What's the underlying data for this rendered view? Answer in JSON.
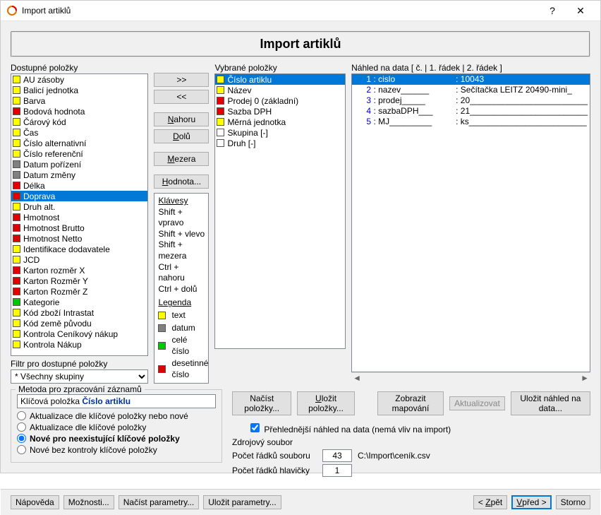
{
  "title": "Import artiklů",
  "panelTitle": "Import artiklů",
  "labels": {
    "available": "Dostupné položky",
    "selected": "Vybrané položky",
    "preview": "Náhled na data [ č. | 1. řádek | 2. řádek ]",
    "filter": "Filtr pro dostupné položky",
    "filterValue": "* Všechny skupiny"
  },
  "buttons": {
    "moveRight": ">>",
    "moveLeft": "<<",
    "up": "Nahoru",
    "down": "Dolů",
    "space": "Mezera",
    "value": "Hodnota...",
    "loadItems": "Načíst položky...",
    "saveItems": "Uložit položky...",
    "showMap": "Zobrazit mapování",
    "refresh": "Aktualizovat",
    "savePreview": "Uložit náhled na data...",
    "help": "Nápověda",
    "options": "Možnosti...",
    "loadParams": "Načíst parametry...",
    "saveParams": "Uložit parametry...",
    "back": "< Zpět",
    "next": "Vpřed >",
    "cancel": "Storno"
  },
  "hints": {
    "keysHdr": "Klávesy",
    "k1": "Shift + vpravo",
    "k2": "Shift + vlevo",
    "k3": "Shift + mezera",
    "k4": "Ctrl + nahoru",
    "k5": "Ctrl + dolů",
    "legendHdr": "Legenda",
    "lText": "text",
    "lDate": "datum",
    "lInt": "celé číslo",
    "lDec": "desetinné číslo"
  },
  "available": [
    {
      "c": "yellow",
      "t": "AU zásoby"
    },
    {
      "c": "yellow",
      "t": "Balicí jednotka"
    },
    {
      "c": "yellow",
      "t": "Barva"
    },
    {
      "c": "red",
      "t": "Bodová hodnota"
    },
    {
      "c": "yellow",
      "t": "Čárový kód"
    },
    {
      "c": "yellow",
      "t": "Čas"
    },
    {
      "c": "yellow",
      "t": "Číslo alternativní"
    },
    {
      "c": "yellow",
      "t": "Číslo referenční"
    },
    {
      "c": "gray",
      "t": "Datum pořízení"
    },
    {
      "c": "gray",
      "t": "Datum změny"
    },
    {
      "c": "red",
      "t": "Délka"
    },
    {
      "c": "red",
      "t": "Doprava",
      "sel": true
    },
    {
      "c": "yellow",
      "t": "Druh alt."
    },
    {
      "c": "red",
      "t": "Hmotnost"
    },
    {
      "c": "red",
      "t": "Hmotnost Brutto"
    },
    {
      "c": "red",
      "t": "Hmotnost Netto"
    },
    {
      "c": "yellow",
      "t": "Identifikace dodavatele"
    },
    {
      "c": "yellow",
      "t": "JCD"
    },
    {
      "c": "red",
      "t": "Karton rozměr X"
    },
    {
      "c": "red",
      "t": "Karton Rozměr Y"
    },
    {
      "c": "red",
      "t": "Karton Rozměr Z"
    },
    {
      "c": "green",
      "t": "Kategorie"
    },
    {
      "c": "yellow",
      "t": "Kód zboží Intrastat"
    },
    {
      "c": "yellow",
      "t": "Kód země původu"
    },
    {
      "c": "yellow",
      "t": "Kontrola Ceníkový nákup"
    },
    {
      "c": "yellow",
      "t": "Kontrola Nákup"
    }
  ],
  "selected": [
    {
      "c": "yellow",
      "t": "Číslo artiklu",
      "sel": true
    },
    {
      "c": "yellow",
      "t": "Název"
    },
    {
      "c": "red",
      "t": "Prodej  0 (základní)"
    },
    {
      "c": "red",
      "t": "Sazba DPH"
    },
    {
      "c": "yellow",
      "t": "Měrná jednotka"
    },
    {
      "c": "white",
      "t": "Skupina  [-]"
    },
    {
      "c": "white",
      "t": "Druh [-]"
    }
  ],
  "preview": [
    {
      "n": "1",
      "k": "cislo",
      "v": "10043"
    },
    {
      "n": "2",
      "k": "nazev______",
      "v": "Sečítačka LEITZ 20490-mini_"
    },
    {
      "n": "3",
      "k": "prodej_____",
      "v": "20_________________________"
    },
    {
      "n": "4",
      "k": "sazbaDPH___",
      "v": "21_________________________"
    },
    {
      "n": "5",
      "k": "MJ_________",
      "v": "ks_________________________"
    }
  ],
  "method": {
    "legend": "Metoda pro zpracování záznamů",
    "keyLabel": "Klíčová položka ",
    "keyValue": "Číslo artiklu",
    "r1": "Aktualizace dle klíčové položky nebo nové",
    "r2": "Aktualizace dle klíčové položky",
    "r3": "Nové pro neexistující klíčové položky",
    "r4": "Nové bez kontroly klíčové položky"
  },
  "source": {
    "checkbox": "Přehlednější náhled na data (nemá vliv na import)",
    "group": "Zdrojový soubor",
    "rowCountLabel": "Počet řádků souboru",
    "rowCount": "43",
    "path": "C:\\Import\\ceník.csv",
    "headerRowsLabel": "Počet řádků hlavičky",
    "headerRows": "1"
  }
}
